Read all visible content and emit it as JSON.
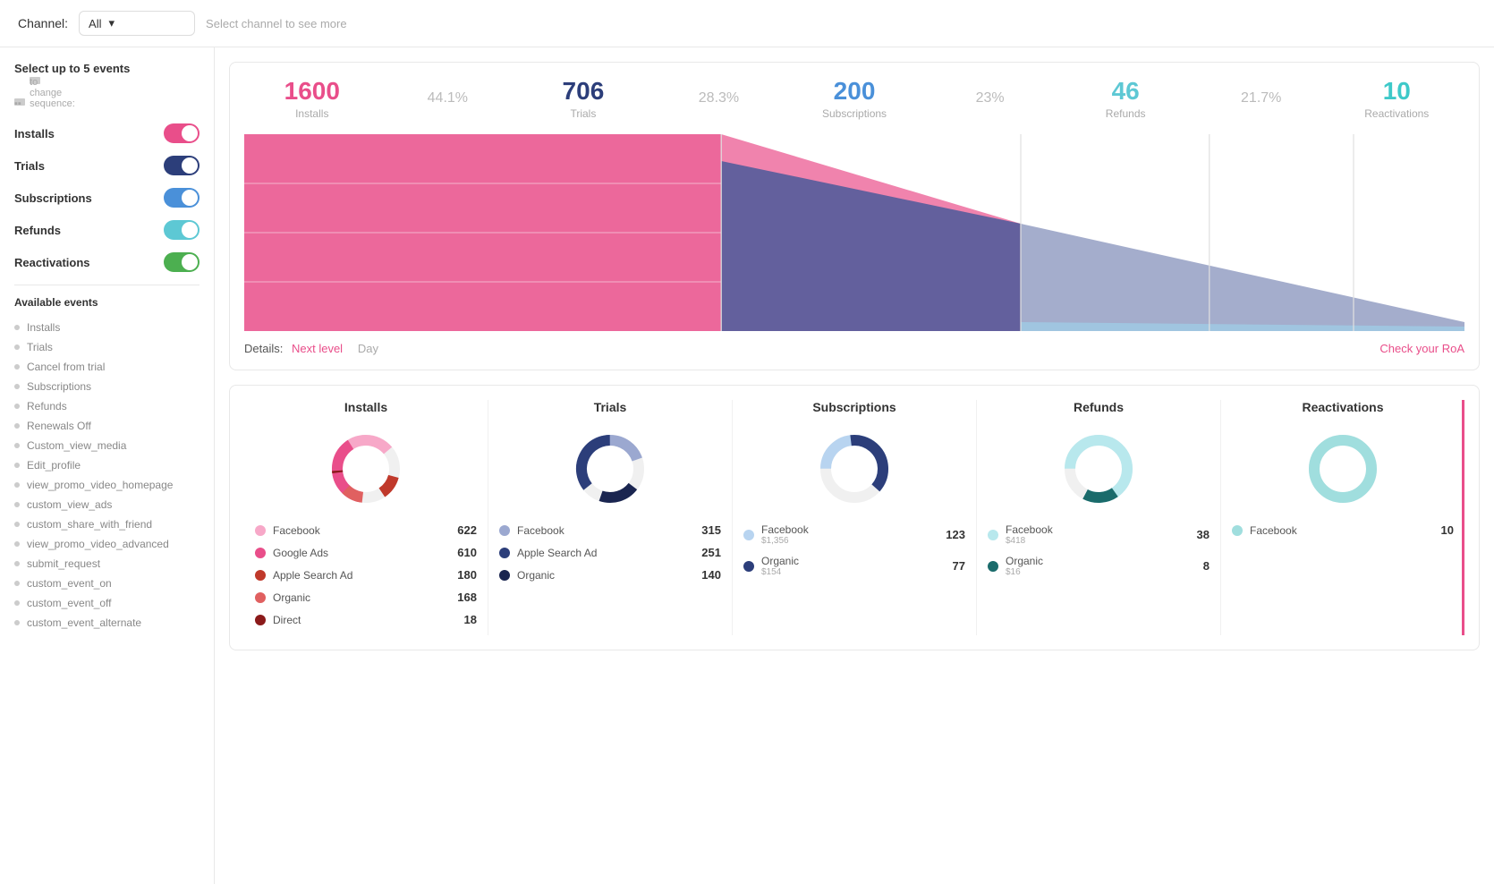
{
  "topbar": {
    "channel_label": "Channel:",
    "channel_value": "All",
    "channel_hint": "Select channel  to see more"
  },
  "sidebar": {
    "select_title": "Select up to 5 events",
    "drag_hint": "Drag and drop",
    "drag_hint2": "to change sequence:",
    "events": [
      {
        "label": "Installs",
        "toggle": "on",
        "color": "pink"
      },
      {
        "label": "Trials",
        "toggle": "on",
        "color": "blue-dark"
      },
      {
        "label": "Subscriptions",
        "toggle": "on",
        "color": "blue"
      },
      {
        "label": "Refunds",
        "toggle": "on",
        "color": "cyan"
      },
      {
        "label": "Reactivations",
        "toggle": "on",
        "color": "green"
      }
    ],
    "available_title": "Available events",
    "available_events": [
      "Installs",
      "Trials",
      "Cancel from trial",
      "Subscriptions",
      "Refunds",
      "Renewals Off",
      "Custom_view_media",
      "Edit_profile",
      "view_promo_video_homepage",
      "custom_view_ads",
      "custom_share_with_friend",
      "view_promo_video_advanced",
      "submit_request",
      "custom_event_on",
      "custom_event_off",
      "custom_event_alternate"
    ]
  },
  "funnel": {
    "metrics": [
      {
        "value": "1600",
        "color": "pink",
        "label": "Installs",
        "pct": ""
      },
      {
        "value": "44.1%",
        "color": "gray",
        "label": "",
        "pct": true
      },
      {
        "value": "706",
        "color": "blue-dark",
        "label": "Trials",
        "pct": ""
      },
      {
        "value": "28.3%",
        "color": "gray",
        "label": "",
        "pct": true
      },
      {
        "value": "200",
        "color": "blue",
        "label": "Subscriptions",
        "pct": ""
      },
      {
        "value": "23%",
        "color": "gray",
        "label": "",
        "pct": true
      },
      {
        "value": "46",
        "color": "cyan",
        "label": "Refunds",
        "pct": ""
      },
      {
        "value": "21.7%",
        "color": "gray",
        "label": "",
        "pct": true
      },
      {
        "value": "10",
        "color": "teal",
        "label": "Reactivations",
        "pct": ""
      }
    ],
    "details_label": "Details:",
    "next_level": "Next level",
    "day": "Day",
    "roa_link": "Check your RoA"
  },
  "breakdown": {
    "columns": [
      {
        "title": "Installs",
        "donut_color": "#e94e8a",
        "rows": [
          {
            "name": "Facebook",
            "sub": "",
            "count": "622",
            "color": "#f7a8c8"
          },
          {
            "name": "Google Ads",
            "sub": "",
            "count": "610",
            "color": "#e94e8a"
          },
          {
            "name": "Apple Search Ad",
            "sub": "",
            "count": "180",
            "color": "#c0392b"
          },
          {
            "name": "Organic",
            "sub": "",
            "count": "168",
            "color": "#e06060"
          },
          {
            "name": "Direct",
            "sub": "",
            "count": "18",
            "color": "#8b1a1a"
          }
        ]
      },
      {
        "title": "Trials",
        "donut_color": "#2c3e7a",
        "rows": [
          {
            "name": "Facebook",
            "sub": "",
            "count": "315",
            "color": "#9ba8d0"
          },
          {
            "name": "Apple Search Ad",
            "sub": "",
            "count": "251",
            "color": "#2c3e7a"
          },
          {
            "name": "Organic",
            "sub": "",
            "count": "140",
            "color": "#1a2550"
          }
        ]
      },
      {
        "title": "Subscriptions",
        "donut_color": "#4a90d9",
        "rows": [
          {
            "name": "Facebook",
            "sub": "$1,356",
            "count": "123",
            "color": "#b8d4f0"
          },
          {
            "name": "Organic",
            "sub": "$154",
            "count": "77",
            "color": "#2c3e7a"
          }
        ]
      },
      {
        "title": "Refunds",
        "donut_color": "#5dc8d4",
        "rows": [
          {
            "name": "Facebook",
            "sub": "$418",
            "count": "38",
            "color": "#b8e8ed"
          },
          {
            "name": "Organic",
            "sub": "$16",
            "count": "8",
            "color": "#1a6b6b"
          }
        ]
      },
      {
        "title": "Reactivations",
        "donut_color": "#3ec9c9",
        "rows": [
          {
            "name": "Facebook",
            "sub": "",
            "count": "10",
            "color": "#a0dede"
          }
        ]
      }
    ]
  }
}
